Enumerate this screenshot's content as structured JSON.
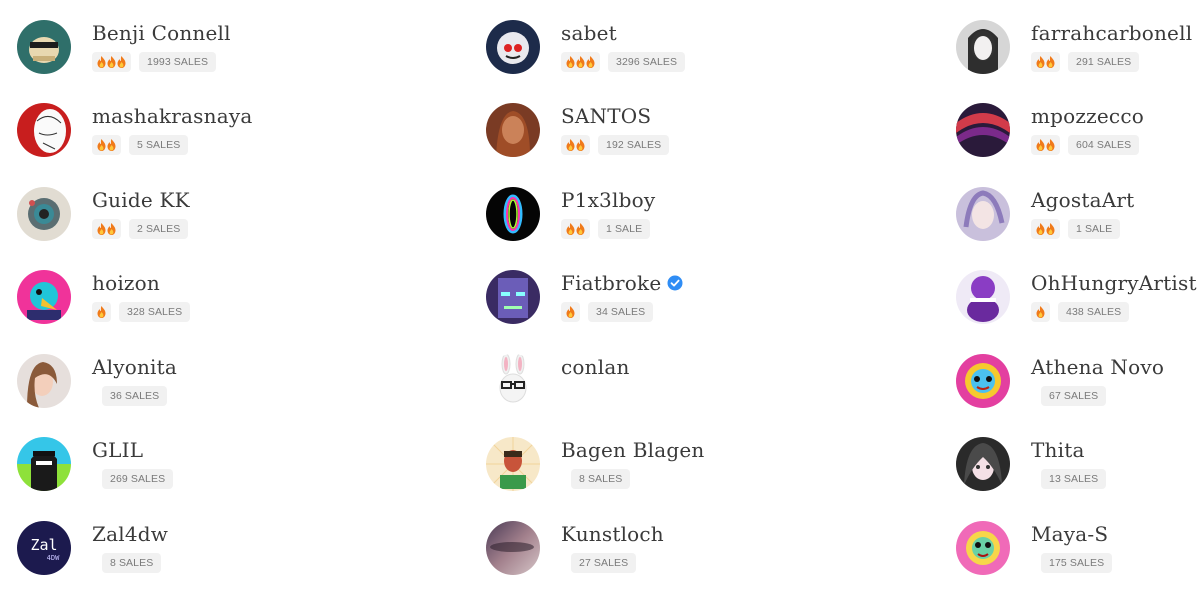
{
  "colors": {
    "text": "#3a3a3a",
    "badge_bg": "#f1f1f1",
    "badge_text": "#7a7a7a",
    "flame": "#f07a1a",
    "verified": "#2f8df5"
  },
  "artists": [
    {
      "name": "Benji Connell",
      "flames": 3,
      "sales": "1993 SALES",
      "avatar": "avatar-teal",
      "verified": false
    },
    {
      "name": "sabet",
      "flames": 3,
      "sales": "3296 SALES",
      "avatar": "avatar-astronaut",
      "verified": false
    },
    {
      "name": "farrahcarbonell",
      "flames": 2,
      "sales": "291 SALES",
      "avatar": "avatar-bw-portrait",
      "verified": false
    },
    {
      "name": "mashakrasnaya",
      "flames": 2,
      "sales": "5 SALES",
      "avatar": "avatar-red-sketch",
      "verified": false
    },
    {
      "name": "SANTOS",
      "flames": 2,
      "sales": "192 SALES",
      "avatar": "avatar-woman-photo",
      "verified": false
    },
    {
      "name": "mpozzecco",
      "flames": 2,
      "sales": "604 SALES",
      "avatar": "avatar-waves",
      "verified": false
    },
    {
      "name": "Guide KK",
      "flames": 2,
      "sales": "2 SALES",
      "avatar": "avatar-eye",
      "verified": false
    },
    {
      "name": "P1x3lboy",
      "flames": 2,
      "sales": "1 SALE",
      "avatar": "avatar-neon-ring",
      "verified": false
    },
    {
      "name": "AgostaArt",
      "flames": 2,
      "sales": "1 SALE",
      "avatar": "avatar-pastel-portrait",
      "verified": false
    },
    {
      "name": "hoizon",
      "flames": 1,
      "sales": "328 SALES",
      "avatar": "avatar-colorful-bird",
      "verified": false
    },
    {
      "name": "Fiatbroke",
      "flames": 1,
      "sales": "34 SALES",
      "avatar": "avatar-cyber-face",
      "verified": true
    },
    {
      "name": "OhHungryArtist",
      "flames": 1,
      "sales": "438 SALES",
      "avatar": "avatar-purple-figure",
      "verified": false
    },
    {
      "name": "Alyonita",
      "flames": 0,
      "sales": "36 SALES",
      "avatar": "avatar-woman-selfie",
      "verified": false
    },
    {
      "name": "conlan",
      "flames": 0,
      "sales": "",
      "avatar": "avatar-bunny",
      "verified": false
    },
    {
      "name": "Athena Novo",
      "flames": 0,
      "sales": "67 SALES",
      "avatar": "avatar-rainbow-face",
      "verified": false
    },
    {
      "name": "GLIL",
      "flames": 0,
      "sales": "269 SALES",
      "avatar": "avatar-hooded-figure",
      "verified": false
    },
    {
      "name": "Bagen Blagen",
      "flames": 0,
      "sales": "8 SALES",
      "avatar": "avatar-cartoon-man",
      "verified": false
    },
    {
      "name": "Thita",
      "flames": 0,
      "sales": "13 SALES",
      "avatar": "avatar-dark-doll",
      "verified": false
    },
    {
      "name": "Zal4dw",
      "flames": 0,
      "sales": "8 SALES",
      "avatar": "avatar-zal-logo",
      "verified": false
    },
    {
      "name": "Kunstloch",
      "flames": 0,
      "sales": "27 SALES",
      "avatar": "avatar-blurred-abstract",
      "verified": false
    },
    {
      "name": "Maya-S",
      "flames": 0,
      "sales": "175 SALES",
      "avatar": "avatar-psychedelic",
      "verified": false
    }
  ],
  "avatar_text": {
    "zal": "Zal",
    "zal_sub": "4DW"
  }
}
